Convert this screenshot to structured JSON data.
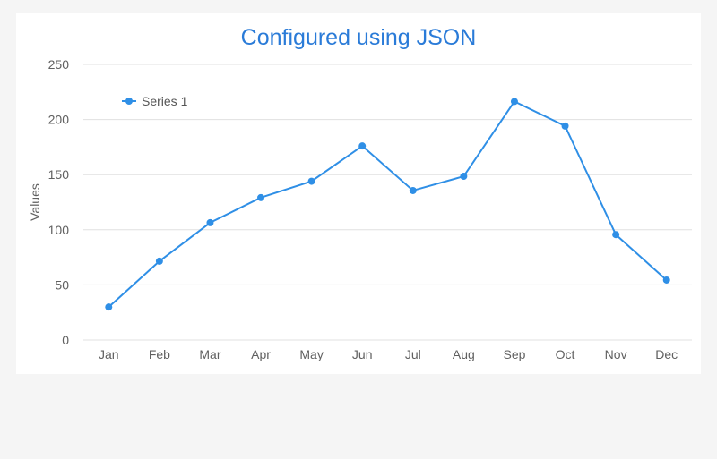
{
  "chart_data": {
    "type": "line",
    "title": "Configured using JSON",
    "xlabel": "",
    "ylabel": "Values",
    "categories": [
      "Jan",
      "Feb",
      "Mar",
      "Apr",
      "May",
      "Jun",
      "Jul",
      "Aug",
      "Sep",
      "Oct",
      "Nov",
      "Dec"
    ],
    "ylim": [
      0,
      250
    ],
    "yticks": [
      0,
      50,
      100,
      150,
      200,
      250
    ],
    "grid": true,
    "legend": "top-left",
    "series": [
      {
        "name": "Series 1",
        "color": "#2f8fe6",
        "values": [
          29.9,
          71.5,
          106.4,
          129.2,
          144.0,
          176.0,
          135.6,
          148.5,
          216.4,
          194.1,
          95.6,
          54.4
        ]
      }
    ]
  }
}
